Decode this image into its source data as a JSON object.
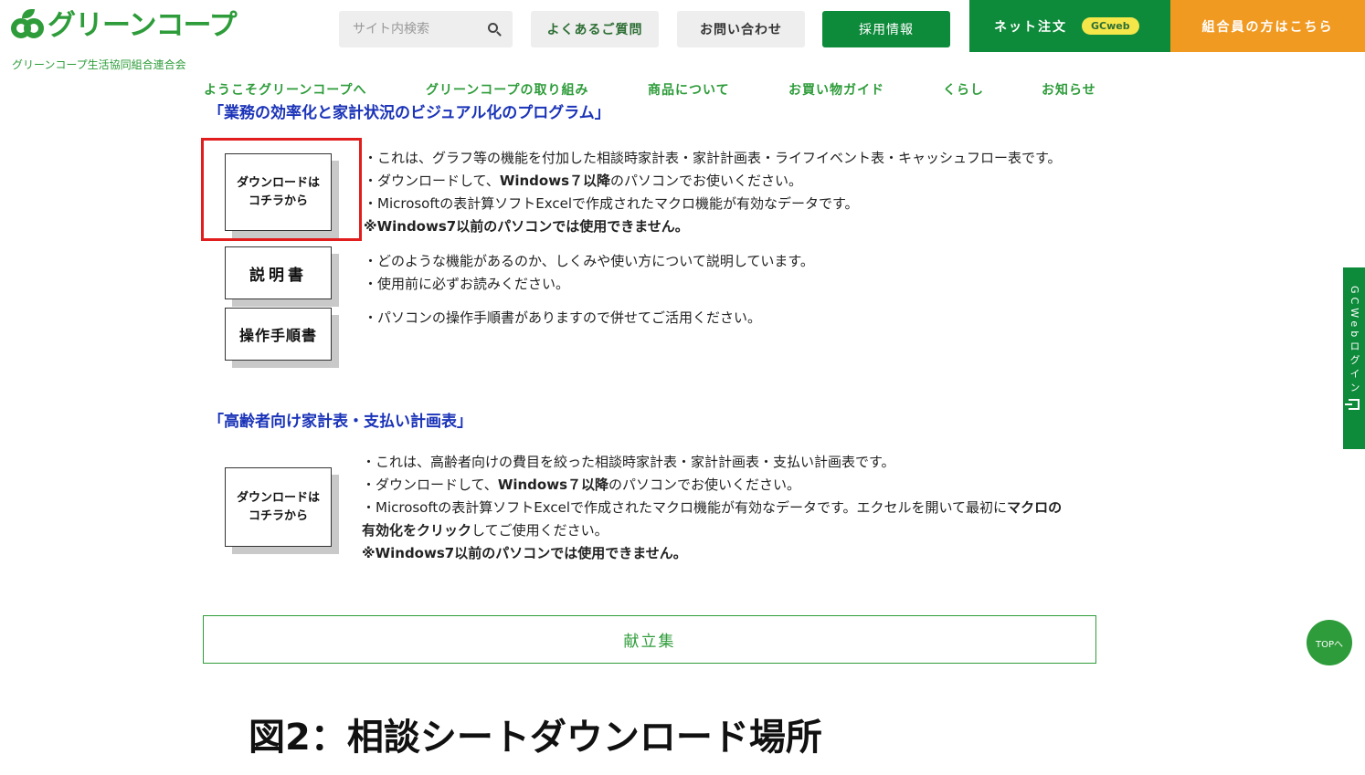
{
  "header": {
    "logo_text": "グリーンコープ",
    "logo_sub": "グリーンコープ生活協同組合連合会",
    "search_placeholder": "サイト内検索",
    "faq_label": "よくあるご質問",
    "contact_label": "お問い合わせ",
    "recruit_label": "採用情報",
    "net_order_label": "ネット注文",
    "gcweb_badge": "GCweb",
    "member_label": "組合員の方はこちら",
    "accent_green": "#0e8a3b",
    "accent_orange": "#f19a22"
  },
  "nav": {
    "items": [
      {
        "label": "ようこそグリーンコープへ"
      },
      {
        "label": "グリーンコープの取り組み"
      },
      {
        "label": "商品について"
      },
      {
        "label": "お買い物ガイド"
      },
      {
        "label": "くらし"
      },
      {
        "label": "お知らせ"
      }
    ]
  },
  "section1": {
    "title": "「業務の効率化と家計状況のビジュアル化のプログラム」",
    "download_label": "ダウンロードは\nコチラから",
    "lines": [
      "・これは、グラフ等の機能を付加した相談時家計表・家計計画表・ライフイベント表・キャッシュフロー表です。",
      "・ダウンロードして、",
      "Windows７以降",
      "のパソコンでお使いください。",
      "・Microsoftの表計算ソフトExcelで作成されたマクロ機能が有効なデータです。",
      "※Windows7以前のパソコンでは使用できません。"
    ],
    "manual_label": "説明書",
    "manual_lines": [
      "・どのような機能があるのか、しくみや使い方について説明しています。",
      "・使用前に必ずお読みください。"
    ],
    "ops_label": "操作手順書",
    "ops_line": "・パソコンの操作手順書がありますので併せてご活用ください。"
  },
  "section2": {
    "title": "「高齢者向け家計表・支払い計画表」",
    "download_label": "ダウンロードは\nコチラから",
    "lines": [
      "・これは、高齢者向けの費目を絞った相談時家計表・家計計画表・支払い計画表です。",
      "・ダウンロードして、",
      "Windows７以降",
      "のパソコンでお使いください。",
      "・Microsoftの表計算ソフトExcelで作成されたマクロ機能が有効なデータです。エクセルを開いて最初に",
      "マクロの",
      "有効化をクリック",
      "してご使用ください。",
      "※Windows7以前のパソコンでは使用できません。"
    ]
  },
  "menu_box_label": "献立集",
  "figure_caption": "図2：相談シートダウンロード場所",
  "side_tab_label": "GCWebログイン",
  "top_button_label": "TOPへ"
}
